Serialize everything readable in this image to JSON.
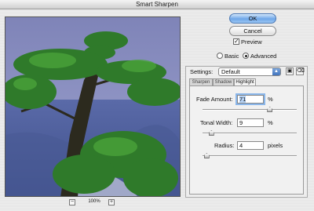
{
  "window": {
    "title": "Smart Sharpen"
  },
  "buttons": {
    "ok": "OK",
    "cancel": "Cancel"
  },
  "preview_checkbox": {
    "label": "Preview",
    "checked": true
  },
  "mode": {
    "options": [
      "Basic",
      "Advanced"
    ],
    "selected": "Advanced"
  },
  "settings": {
    "label": "Settings:",
    "value": "Default"
  },
  "tabs": [
    "Sharpen",
    "Shadow",
    "Highlight"
  ],
  "active_tab": "Highlight",
  "controls": {
    "fade_amount": {
      "label": "Fade Amount:",
      "value": "71",
      "unit": "%",
      "slider_fraction": 0.71
    },
    "tonal_width": {
      "label": "Tonal Width:",
      "value": "9",
      "unit": "%",
      "slider_fraction": 0.09
    },
    "radius": {
      "label": "Radius:",
      "value": "4",
      "unit": "pixels",
      "slider_fraction": 0.04
    }
  },
  "zoom": {
    "level": "100%",
    "minus": "−",
    "plus": "+"
  },
  "icons": {
    "save": "save-settings-icon",
    "delete": "delete-settings-icon"
  }
}
